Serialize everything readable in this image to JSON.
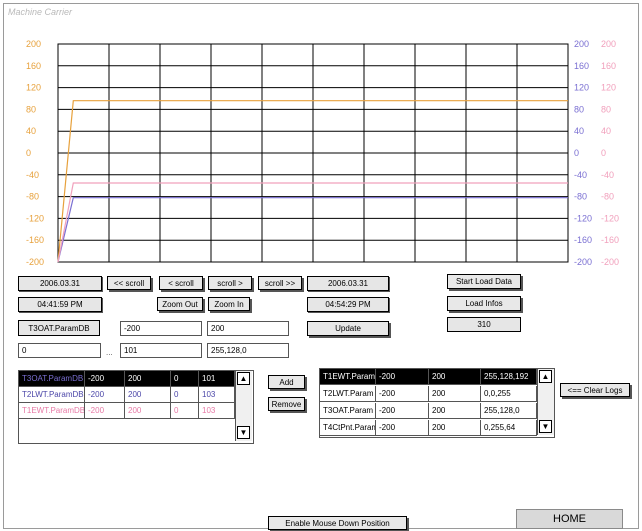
{
  "window": {
    "title": "Machine Carrier"
  },
  "chart_data": {
    "type": "line",
    "ylim": [
      -200,
      200
    ],
    "left_ticks": [
      "200",
      "160",
      "120",
      "80",
      "40",
      "0",
      "-40",
      "-80",
      "-120",
      "-160",
      "-200"
    ],
    "right_ticks_a": [
      "200",
      "160",
      "120",
      "80",
      "40",
      "0",
      "-40",
      "-80",
      "-120",
      "-160",
      "-200"
    ],
    "right_ticks_b": [
      "200",
      "160",
      "120",
      "80",
      "40",
      "0",
      "-40",
      "-80",
      "-120",
      "-160",
      "-200"
    ],
    "grid": true,
    "x": [
      0,
      0.03,
      1
    ],
    "series": [
      {
        "name": "T1EWT.Param",
        "color": "#e7a13c",
        "values": [
          -200,
          96,
          96
        ]
      },
      {
        "name": "T2LWT.Param",
        "color": "#7a6fd2",
        "values": [
          -200,
          -82,
          -82
        ]
      },
      {
        "name": "T3OAT.Param",
        "color": "#f1a0bc",
        "values": [
          -200,
          -55,
          -55
        ]
      }
    ]
  },
  "colors": {
    "left_axis": "#e7a13c",
    "right_axis_a": "#7a6fd2",
    "right_axis_b": "#f1a0bc"
  },
  "controls": {
    "date_start": "2006.03.31",
    "time_start": "04:41:59 PM",
    "scroll_back_far": "<< scroll",
    "scroll_back": "< scroll",
    "scroll_fwd": "scroll >",
    "scroll_fwd_far": "scroll >>",
    "zoom_out": "Zoom Out",
    "zoom_in": "Zoom In",
    "date_end": "2006.03.31",
    "time_end": "04:54:29 PM",
    "start_load": "Start Load Data",
    "load_infos": "Load Infos",
    "load_count": "310",
    "param_name": "T3OAT.ParamDB",
    "min_value": "-200",
    "max_value": "200",
    "update": "Update",
    "range_from": "0",
    "range_sep": "...",
    "range_to": "101",
    "color_value": "255,128,0",
    "add": "Add",
    "remove": "Remove",
    "clear_logs": "<== Clear Logs",
    "enable_mouse": "Enable Mouse Down Position",
    "home": "HOME"
  },
  "left_table": {
    "rows": [
      {
        "c": [
          "T3OAT.ParamDB",
          "-200",
          "200",
          "0",
          "101"
        ],
        "selected": true,
        "color": "#7a6fd2"
      },
      {
        "c": [
          "T2LWT.ParamDB",
          "-200",
          "200",
          "0",
          "103"
        ],
        "selected": false,
        "color": "#4b46a8"
      },
      {
        "c": [
          "T1EWT.ParamDB",
          "-200",
          "200",
          "0",
          "103"
        ],
        "selected": false,
        "color": "#e77aa6"
      }
    ]
  },
  "right_table": {
    "rows": [
      {
        "c": [
          "T1EWT.Param",
          "-200",
          "200",
          "255,128,192"
        ],
        "selected": true
      },
      {
        "c": [
          "T2LWT.Param",
          "-200",
          "200",
          "0,0,255"
        ],
        "selected": false
      },
      {
        "c": [
          "T3OAT.Param",
          "-200",
          "200",
          "255,128,0"
        ],
        "selected": false
      },
      {
        "c": [
          "T4CtPnt.Param",
          "-200",
          "200",
          "0,255,64"
        ],
        "selected": false
      }
    ]
  }
}
